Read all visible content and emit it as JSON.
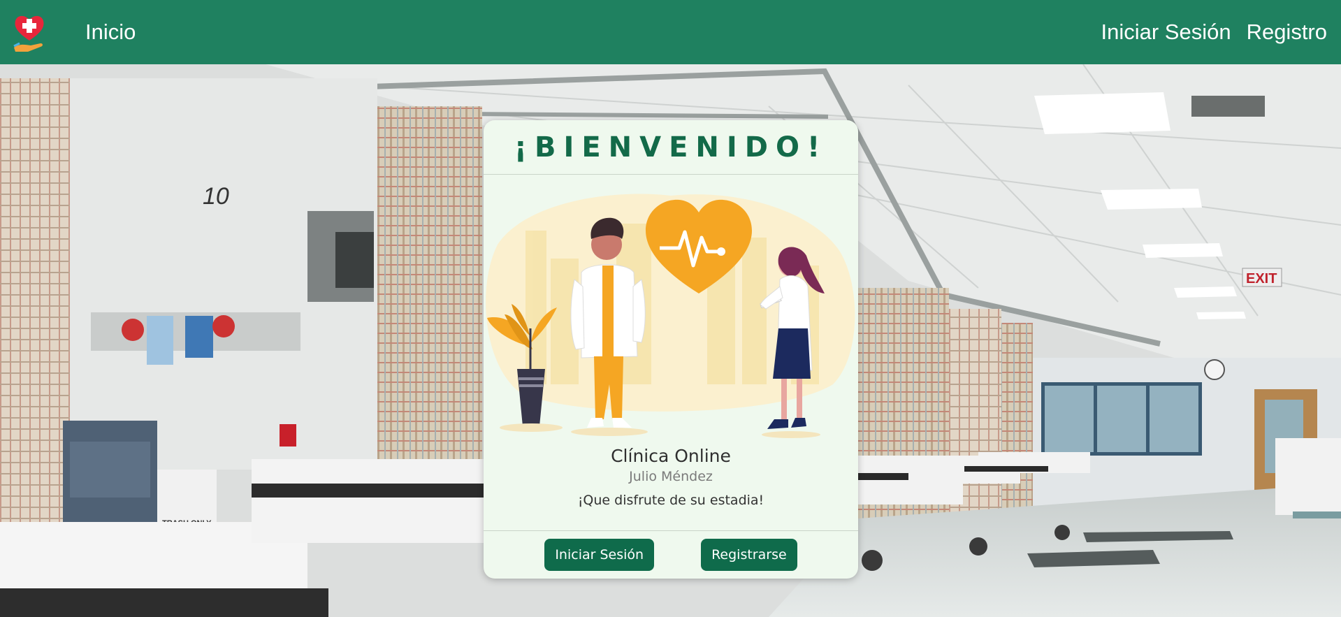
{
  "navbar": {
    "logo_icon": "heart-cross-hand-icon",
    "home_label": "Inicio",
    "login_label": "Iniciar Sesión",
    "register_label": "Registro",
    "background_color": "#1f8160"
  },
  "background": {
    "room_number": "10",
    "exit_sign": "EXIT",
    "trash_label": "TRASH ONLY"
  },
  "card": {
    "title": "¡BIENVENIDO!",
    "clinic_name": "Clínica Online",
    "author": "Julio Méndez",
    "message": "¡Que disfrute de su estadia!",
    "login_button": "Iniciar Sesión",
    "register_button": "Registrarse",
    "accent_color": "#136a49",
    "illustration_accent": "#f5a623"
  }
}
